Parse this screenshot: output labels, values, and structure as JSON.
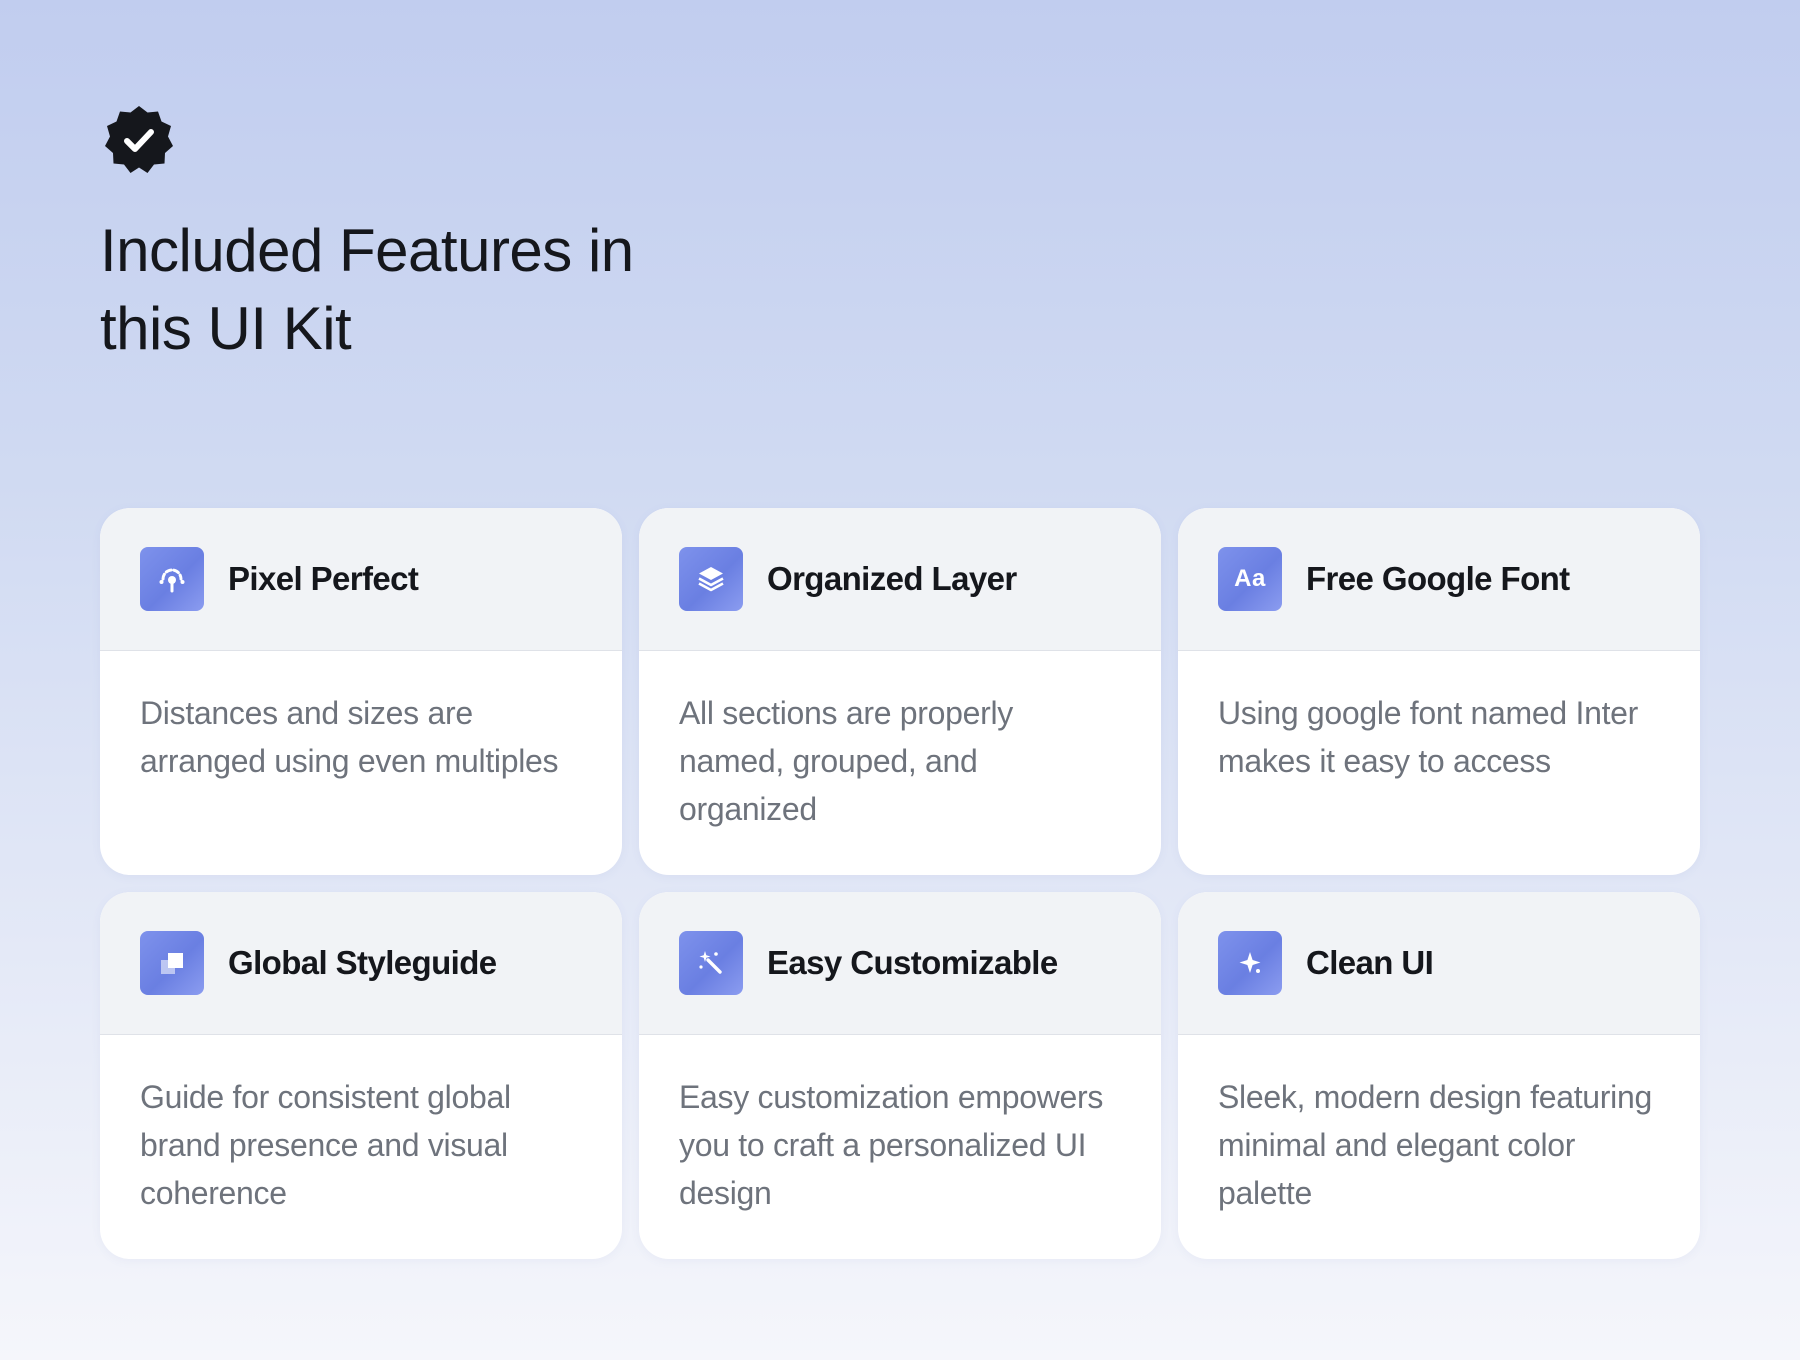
{
  "header": {
    "badge_icon": "verified-badge-icon",
    "title_line1": "Included Features in",
    "title_line2": "this UI Kit"
  },
  "colors": {
    "accent": "#7286e6",
    "card_header_bg": "#f1f3f6",
    "description_text": "#6e737c"
  },
  "features": [
    {
      "icon": "pixel-target-icon",
      "title": "Pixel Perfect",
      "description": "Distances and sizes are arranged using even multiples"
    },
    {
      "icon": "layers-icon",
      "title": "Organized Layer",
      "description": "All sections are properly named, grouped, and organized"
    },
    {
      "icon": "font-icon",
      "icon_text": "Aa",
      "title": "Free Google Font",
      "description": "Using google font named Inter makes it easy  to access"
    },
    {
      "icon": "styleguide-icon",
      "title": "Global Styleguide",
      "description": "Guide for consistent global brand presence and visual coherence"
    },
    {
      "icon": "magic-wand-icon",
      "title": "Easy Customizable",
      "description": "Easy customization empowers you to craft a personalized UI design"
    },
    {
      "icon": "sparkle-icon",
      "title": "Clean UI",
      "description": "Sleek, modern design featuring minimal and elegant color palette"
    }
  ]
}
